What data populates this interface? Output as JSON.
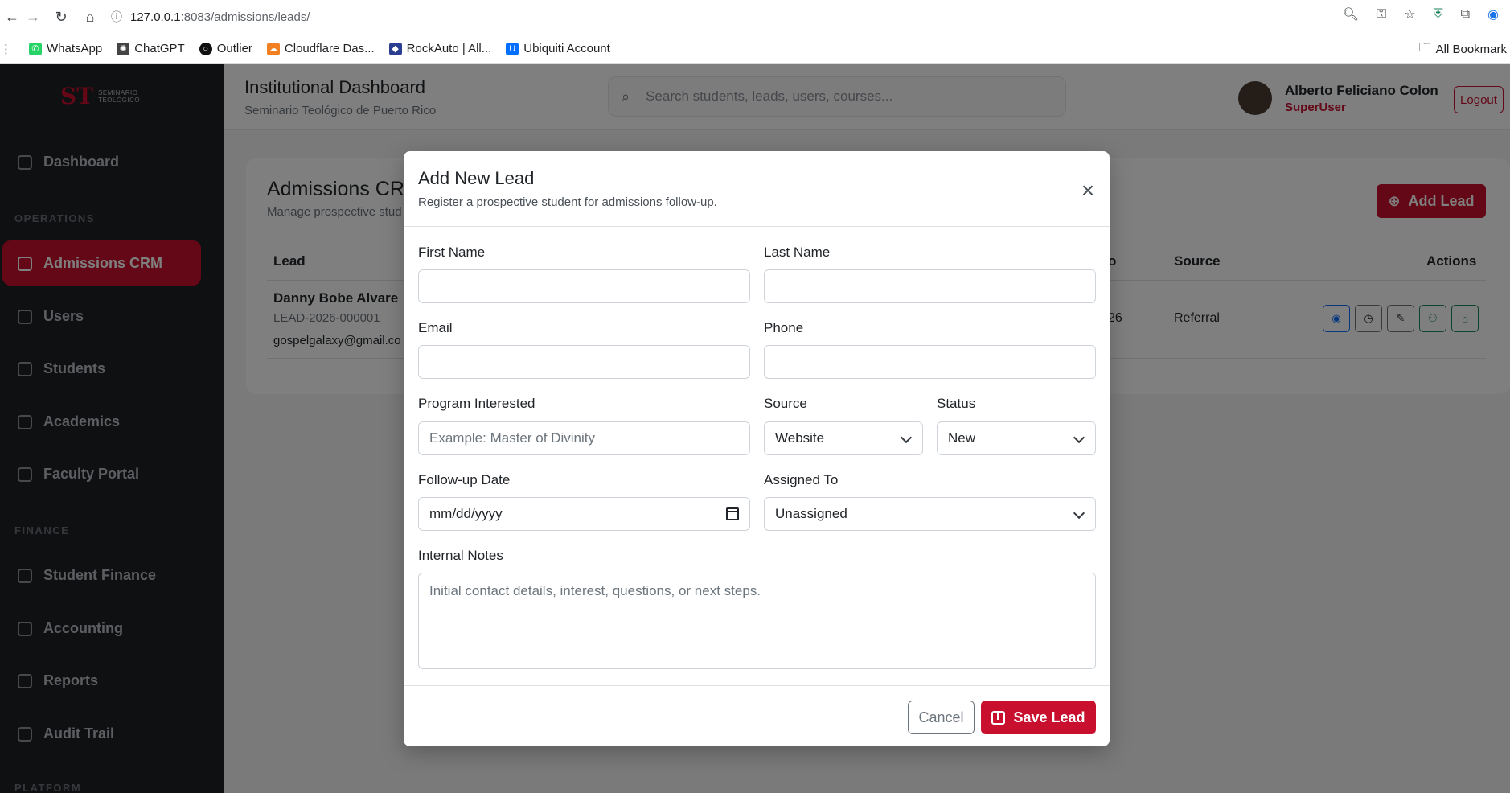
{
  "browser": {
    "url_host": "127.0.0.1",
    "url_path": ":8083/admissions/leads/",
    "bookmarks": [
      {
        "label": "WhatsApp",
        "color": "#25D366"
      },
      {
        "label": "ChatGPT",
        "color": "#444444"
      },
      {
        "label": "Outlier",
        "color": "#111111"
      },
      {
        "label": "Cloudflare Das...",
        "color": "#F38020"
      },
      {
        "label": "RockAuto | All...",
        "color": "#2c3e91"
      },
      {
        "label": "Ubiquiti Account",
        "color": "#006fff"
      }
    ],
    "all_bookmarks": "All Bookmark"
  },
  "sidebar": {
    "logo_line1": "SEMINARIO",
    "logo_line2": "TEOLÓGICO",
    "items": [
      {
        "label": "Dashboard"
      },
      {
        "label": "Admissions CRM"
      },
      {
        "label": "Users"
      },
      {
        "label": "Students"
      },
      {
        "label": "Academics"
      },
      {
        "label": "Faculty Portal"
      },
      {
        "label": "Student Finance"
      },
      {
        "label": "Accounting"
      },
      {
        "label": "Reports"
      },
      {
        "label": "Audit Trail"
      }
    ],
    "sections": [
      "OPERATIONS",
      "FINANCE",
      "PLATFORM"
    ]
  },
  "header": {
    "title": "Institutional Dashboard",
    "subtitle": "Seminario Teológico de Puerto Rico",
    "search_placeholder": "Search students, leads, users, courses...",
    "user_name": "Alberto Feliciano Colon",
    "user_role": "SuperUser",
    "logout_label": "Logout"
  },
  "page": {
    "title": "Admissions CR",
    "subtitle": "Manage prospective stud",
    "add_lead_label": "Add Lead",
    "columns": {
      "lead": "Lead",
      "col_partial": "o",
      "source": "Source",
      "actions": "Actions"
    },
    "row": {
      "name": "Danny Bobe Alvare",
      "code": "LEAD-2026-000001",
      "email": "gospelgalaxy@gmail.co",
      "partial": "26",
      "source": "Referral"
    }
  },
  "modal": {
    "title": "Add New Lead",
    "subtitle": "Register a prospective student for admissions follow-up.",
    "fields": {
      "first_name": {
        "label": "First Name",
        "value": ""
      },
      "last_name": {
        "label": "Last Name",
        "value": ""
      },
      "email": {
        "label": "Email",
        "value": ""
      },
      "phone": {
        "label": "Phone",
        "value": ""
      },
      "program": {
        "label": "Program Interested",
        "placeholder": "Example: Master of Divinity"
      },
      "source": {
        "label": "Source",
        "value": "Website"
      },
      "status": {
        "label": "Status",
        "value": "New"
      },
      "follow_up": {
        "label": "Follow-up Date",
        "value": "mm/dd/yyyy"
      },
      "assigned": {
        "label": "Assigned To",
        "value": "Unassigned"
      },
      "notes": {
        "label": "Internal Notes",
        "placeholder": "Initial contact details, interest, questions, or next steps."
      }
    },
    "cancel_label": "Cancel",
    "save_label": "Save Lead"
  },
  "colors": {
    "brand": "#c8102e",
    "sidebar": "#1f2124"
  }
}
